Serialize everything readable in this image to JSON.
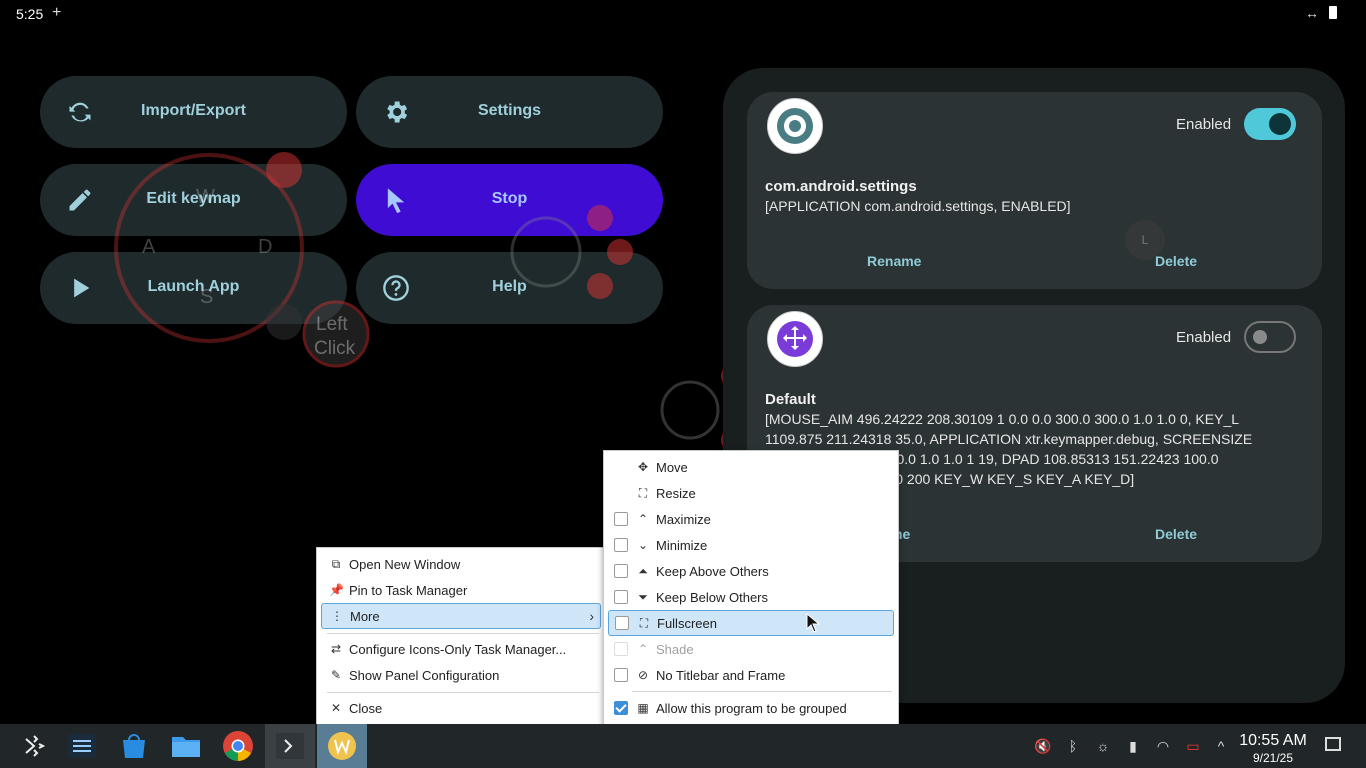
{
  "status_bar": {
    "time": "5:25",
    "plus": "+",
    "arrows": "↔"
  },
  "buttons": {
    "import_export": "Import/Export",
    "settings": "Settings",
    "edit_keymap": "Edit keymap",
    "stop": "Stop",
    "launch_app": "Launch App",
    "help": "Help"
  },
  "overlay": {
    "w": "W",
    "a": "A",
    "s": "S",
    "d": "D",
    "left_click_1": "Left",
    "left_click_2": "Click",
    "l": "L"
  },
  "profiles": [
    {
      "enabled_label": "Enabled",
      "enabled": true,
      "name": "com.android.settings",
      "description": "[APPLICATION com.android.settings, ENABLED]",
      "rename": "Rename",
      "delete": "Delete"
    },
    {
      "enabled_label": "Enabled",
      "enabled": false,
      "name": "Default",
      "description_lines": [
        "[MOUSE_AIM 496.24222 208.30109 1 0.0 0.0 300.0 300.0 1.0 1.0 0, KEY_L",
        "1109.875 211.24318 35.0, APPLICATION xtr.keymapper.debug, SCREENSIZE",
        "640.0 360.0 1.0 1.0 1 19, DPAD 108.85313 151.22423 100.0",
        "3 200 200 KEY_W KEY_S KEY_A KEY_D]"
      ],
      "rename": "me",
      "delete": "Delete"
    }
  ],
  "context_menu": {
    "items": [
      {
        "icon": "new-window-icon",
        "label": "Open New Window"
      },
      {
        "icon": "pin-icon",
        "label": "Pin to Task Manager"
      },
      {
        "icon": "more-icon",
        "label": "More"
      },
      {
        "icon": "configure-icon",
        "label": "Configure Icons-Only Task Manager..."
      },
      {
        "icon": "pencil-icon",
        "label": "Show Panel Configuration"
      },
      {
        "icon": "close-icon",
        "label": "Close"
      }
    ]
  },
  "submenu": {
    "items": [
      {
        "icon": "move-icon",
        "label": "Move",
        "checkbox": null
      },
      {
        "icon": "resize-icon",
        "label": "Resize",
        "checkbox": null
      },
      {
        "icon": "maximize-icon",
        "label": "Maximize",
        "checkbox": false
      },
      {
        "icon": "minimize-icon",
        "label": "Minimize",
        "checkbox": false
      },
      {
        "icon": "keep-above-icon",
        "label": "Keep Above Others",
        "checkbox": false
      },
      {
        "icon": "keep-below-icon",
        "label": "Keep Below Others",
        "checkbox": false
      },
      {
        "icon": "fullscreen-icon",
        "label": "Fullscreen",
        "checkbox": false
      },
      {
        "icon": "shade-icon",
        "label": "Shade",
        "checkbox": false,
        "disabled": true
      },
      {
        "icon": "no-titlebar-icon",
        "label": "No Titlebar and Frame",
        "checkbox": false
      },
      {
        "icon": "group-icon",
        "label": "Allow this program to be grouped",
        "checkbox": true
      }
    ]
  },
  "taskbar": {
    "clock_time": "10:55 AM",
    "clock_date": "9/21/25",
    "apps": [
      "app-launcher-icon",
      "system-settings-icon",
      "discover-store-icon",
      "file-manager-icon",
      "chrome-icon",
      "terminal-icon",
      "keymapper-app-icon"
    ],
    "tray": [
      "muted-volume-icon",
      "bluetooth-icon",
      "brightness-icon",
      "battery-icon",
      "wifi-icon",
      "power-icon",
      "tray-expand-icon",
      "show-desktop-icon"
    ]
  }
}
